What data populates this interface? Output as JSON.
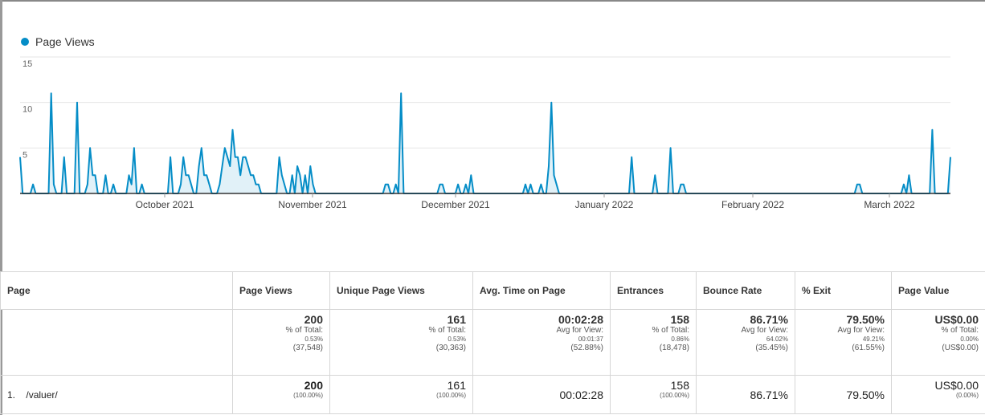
{
  "legend": {
    "label": "Page Views",
    "color": "#058dc7"
  },
  "chart_data": {
    "type": "area",
    "series": [
      {
        "name": "Page Views",
        "values": [
          4,
          0,
          0,
          0,
          0,
          1,
          0,
          0,
          0,
          0,
          0,
          0,
          11,
          1,
          0,
          0,
          0,
          4,
          0,
          0,
          0,
          0,
          10,
          0,
          0,
          0,
          1,
          5,
          2,
          2,
          0,
          0,
          0,
          2,
          0,
          0,
          1,
          0,
          0,
          0,
          0,
          0,
          2,
          1,
          5,
          0,
          0,
          1,
          0,
          0,
          0,
          0,
          0,
          0,
          0,
          0,
          0,
          0,
          4,
          0,
          0,
          0,
          1,
          4,
          2,
          2,
          1,
          0,
          0,
          3,
          5,
          2,
          2,
          1,
          0,
          0,
          0,
          1,
          3,
          5,
          4,
          3,
          7,
          4,
          4,
          2,
          4,
          4,
          3,
          2,
          2,
          1,
          1,
          0,
          0,
          0,
          0,
          0,
          0,
          0,
          4,
          2,
          1,
          0,
          0,
          2,
          0,
          3,
          2,
          0,
          2,
          0,
          3,
          1,
          0,
          0,
          0,
          0,
          0,
          0,
          0,
          0,
          0,
          0,
          0,
          0,
          0,
          0,
          0,
          0,
          0,
          0,
          0,
          0,
          0,
          0,
          0,
          0,
          0,
          0,
          0,
          1,
          1,
          0,
          0,
          1,
          0,
          11,
          0,
          0,
          0,
          0,
          0,
          0,
          0,
          0,
          0,
          0,
          0,
          0,
          0,
          0,
          1,
          1,
          0,
          0,
          0,
          0,
          0,
          1,
          0,
          0,
          1,
          0,
          2,
          0,
          0,
          0,
          0,
          0,
          0,
          0,
          0,
          0,
          0,
          0,
          0,
          0,
          0,
          0,
          0,
          0,
          0,
          0,
          0,
          1,
          0,
          1,
          0,
          0,
          0,
          1,
          0,
          0,
          3,
          10,
          2,
          1,
          0,
          0,
          0,
          0,
          0,
          0,
          0,
          0,
          0,
          0,
          0,
          0,
          0,
          0,
          0,
          0,
          0,
          0,
          0,
          0,
          0,
          0,
          0,
          0,
          0,
          0,
          0,
          0,
          4,
          0,
          0,
          0,
          0,
          0,
          0,
          0,
          0,
          2,
          0,
          0,
          0,
          0,
          0,
          5,
          0,
          0,
          0,
          1,
          1,
          0,
          0,
          0,
          0,
          0,
          0,
          0,
          0,
          0,
          0,
          0,
          0,
          0,
          0,
          0,
          0,
          0,
          0,
          0,
          0,
          0,
          0,
          0,
          0,
          0,
          0,
          0,
          0,
          0,
          0,
          0,
          0,
          0,
          0,
          0,
          0,
          0,
          0,
          0,
          0,
          0,
          0,
          0,
          0,
          0,
          0,
          0,
          0,
          0,
          0,
          0,
          0,
          0,
          0,
          0,
          0,
          0,
          0,
          0,
          0,
          0,
          0,
          0,
          0,
          0,
          0,
          1,
          1,
          0,
          0,
          0,
          0,
          0,
          0,
          0,
          0,
          0,
          0,
          0,
          0,
          0,
          0,
          0,
          0,
          1,
          0,
          2,
          0,
          0,
          0,
          0,
          0,
          0,
          0,
          0,
          7,
          0,
          0,
          0,
          0,
          0,
          0,
          4
        ]
      }
    ],
    "y_ticks": [
      5,
      10,
      15
    ],
    "ylim": [
      0,
      15
    ],
    "x_tick_labels": [
      "October 2021",
      "November 2021",
      "December 2021",
      "January 2022",
      "February 2022",
      "March 2022"
    ],
    "grid": true
  },
  "table": {
    "headers": [
      "Page",
      "Page Views",
      "Unique Page Views",
      "Avg. Time on Page",
      "Entrances",
      "Bounce Rate",
      "% Exit",
      "Page Value"
    ],
    "totals": [
      {
        "main": "200",
        "l1": "% of Total:",
        "l2": "0.53%",
        "l3": "(37,548)"
      },
      {
        "main": "161",
        "l1": "% of Total:",
        "l2": "0.53%",
        "l3": "(30,363)"
      },
      {
        "main": "00:02:28",
        "l1": "Avg for View:",
        "l2": "00:01:37",
        "l3": "(52.88%)"
      },
      {
        "main": "158",
        "l1": "% of Total:",
        "l2": "0.86%",
        "l3": "(18,478)"
      },
      {
        "main": "86.71%",
        "l1": "Avg for View:",
        "l2": "64.02%",
        "l3": "(35.45%)"
      },
      {
        "main": "79.50%",
        "l1": "Avg for View:",
        "l2": "49.21%",
        "l3": "(61.55%)"
      },
      {
        "main": "US$0.00",
        "l1": "% of Total:",
        "l2": "0.00%",
        "l3": "(US$0.00)"
      }
    ],
    "rows": [
      {
        "num": "1.",
        "page": "/valuer/",
        "page_views": "200",
        "page_views_pct": "(100.00%)",
        "unique": "161",
        "unique_pct": "(100.00%)",
        "avg_time": "00:02:28",
        "entrances": "158",
        "entrances_pct": "(100.00%)",
        "bounce": "86.71%",
        "exit": "79.50%",
        "value": "US$0.00",
        "value_pct": "(0.00%)"
      }
    ]
  }
}
